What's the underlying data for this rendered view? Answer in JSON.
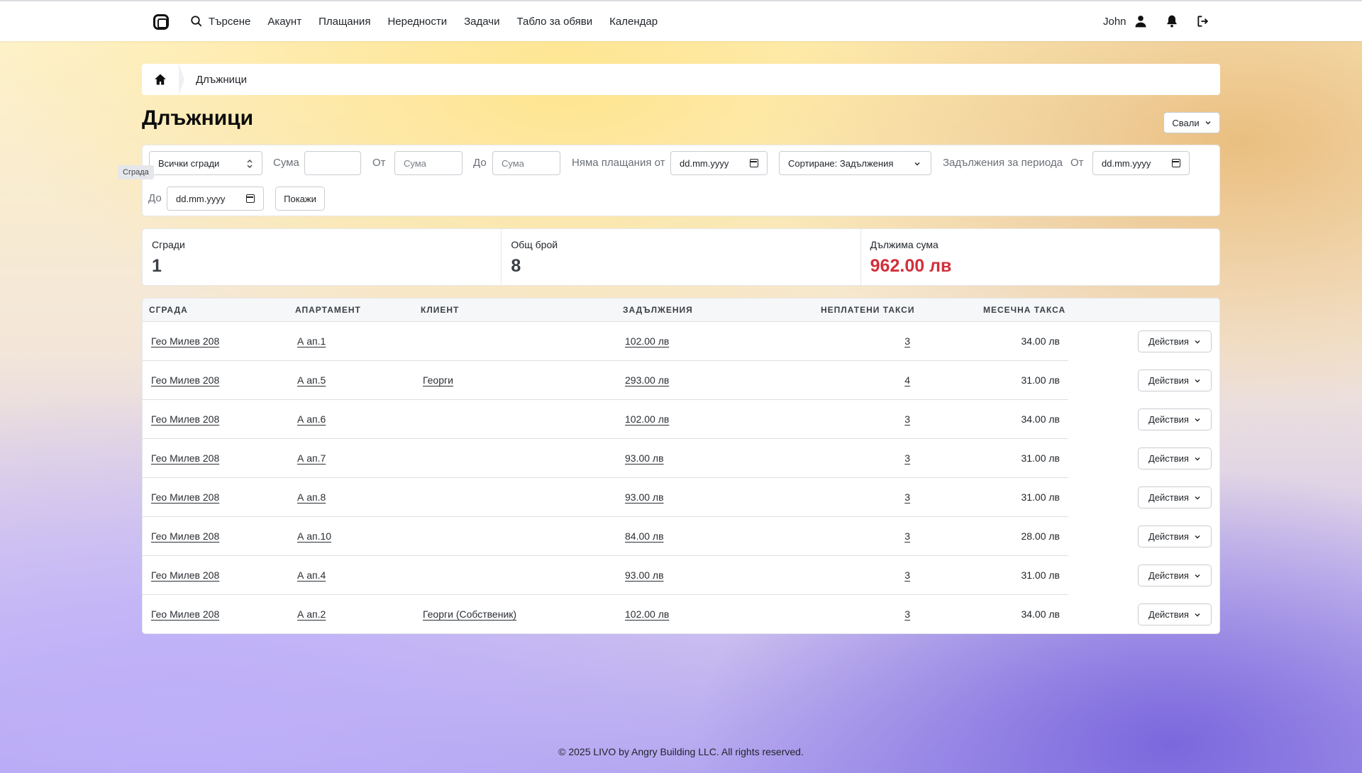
{
  "nav": {
    "search_label": "Търсене",
    "items": [
      "Акаунт",
      "Плащания",
      "Нередности",
      "Задачи",
      "Табло за обяви",
      "Календар"
    ],
    "user_name": "John"
  },
  "breadcrumb": {
    "current": "Длъжници"
  },
  "page": {
    "title": "Длъжници",
    "download_label": "Свали"
  },
  "filters": {
    "building_select": "Всички сгради",
    "tooltip": "Сграда",
    "sum_label": "Сума",
    "sum_value": "",
    "from_label": "От",
    "from_placeholder": "Сума",
    "to_label": "До",
    "to_placeholder": "Сума",
    "no_payments_label": "Няма плащания от",
    "date_placeholder": "dd.mm.yyyy",
    "sort_select": "Сортиране: Задължения",
    "period_label": "Задължения за периода",
    "period_from_label": "От",
    "period_to_label": "До",
    "show_button": "Покажи"
  },
  "stats": {
    "buildings_label": "Сгради",
    "buildings_value": "1",
    "total_label": "Общ брой",
    "total_value": "8",
    "owed_label": "Дължима сума",
    "owed_value": "962.00 лв"
  },
  "table": {
    "headers": [
      "СГРАДА",
      "АПАРТАМЕНТ",
      "КЛИЕНТ",
      "ЗАДЪЛЖЕНИЯ",
      "НЕПЛАТЕНИ ТАКСИ",
      "МЕСЕЧНА ТАКСА"
    ],
    "action_label": "Действия",
    "rows": [
      {
        "building": "Гео Милев 208",
        "apartment": "А ап.1",
        "client": "",
        "debt": "102.00 лв",
        "unpaid": "3",
        "monthly": "34.00 лв"
      },
      {
        "building": "Гео Милев 208",
        "apartment": "А ап.5",
        "client": "Георги",
        "debt": "293.00 лв",
        "unpaid": "4",
        "monthly": "31.00 лв"
      },
      {
        "building": "Гео Милев 208",
        "apartment": "А ап.6",
        "client": "",
        "debt": "102.00 лв",
        "unpaid": "3",
        "monthly": "34.00 лв"
      },
      {
        "building": "Гео Милев 208",
        "apartment": "А ап.7",
        "client": "",
        "debt": "93.00 лв",
        "unpaid": "3",
        "monthly": "31.00 лв"
      },
      {
        "building": "Гео Милев 208",
        "apartment": "А ап.8",
        "client": "",
        "debt": "93.00 лв",
        "unpaid": "3",
        "monthly": "31.00 лв"
      },
      {
        "building": "Гео Милев 208",
        "apartment": "А ап.10",
        "client": "",
        "debt": "84.00 лв",
        "unpaid": "3",
        "monthly": "28.00 лв"
      },
      {
        "building": "Гео Милев 208",
        "apartment": "А ап.4",
        "client": "",
        "debt": "93.00 лв",
        "unpaid": "3",
        "monthly": "31.00 лв"
      },
      {
        "building": "Гео Милев 208",
        "apartment": "А ап.2",
        "client": "Георги (Собственик)",
        "debt": "102.00 лв",
        "unpaid": "3",
        "monthly": "34.00 лв"
      }
    ]
  },
  "footer": {
    "text": "© 2025 LIVO by Angry Building LLC. All rights reserved."
  }
}
